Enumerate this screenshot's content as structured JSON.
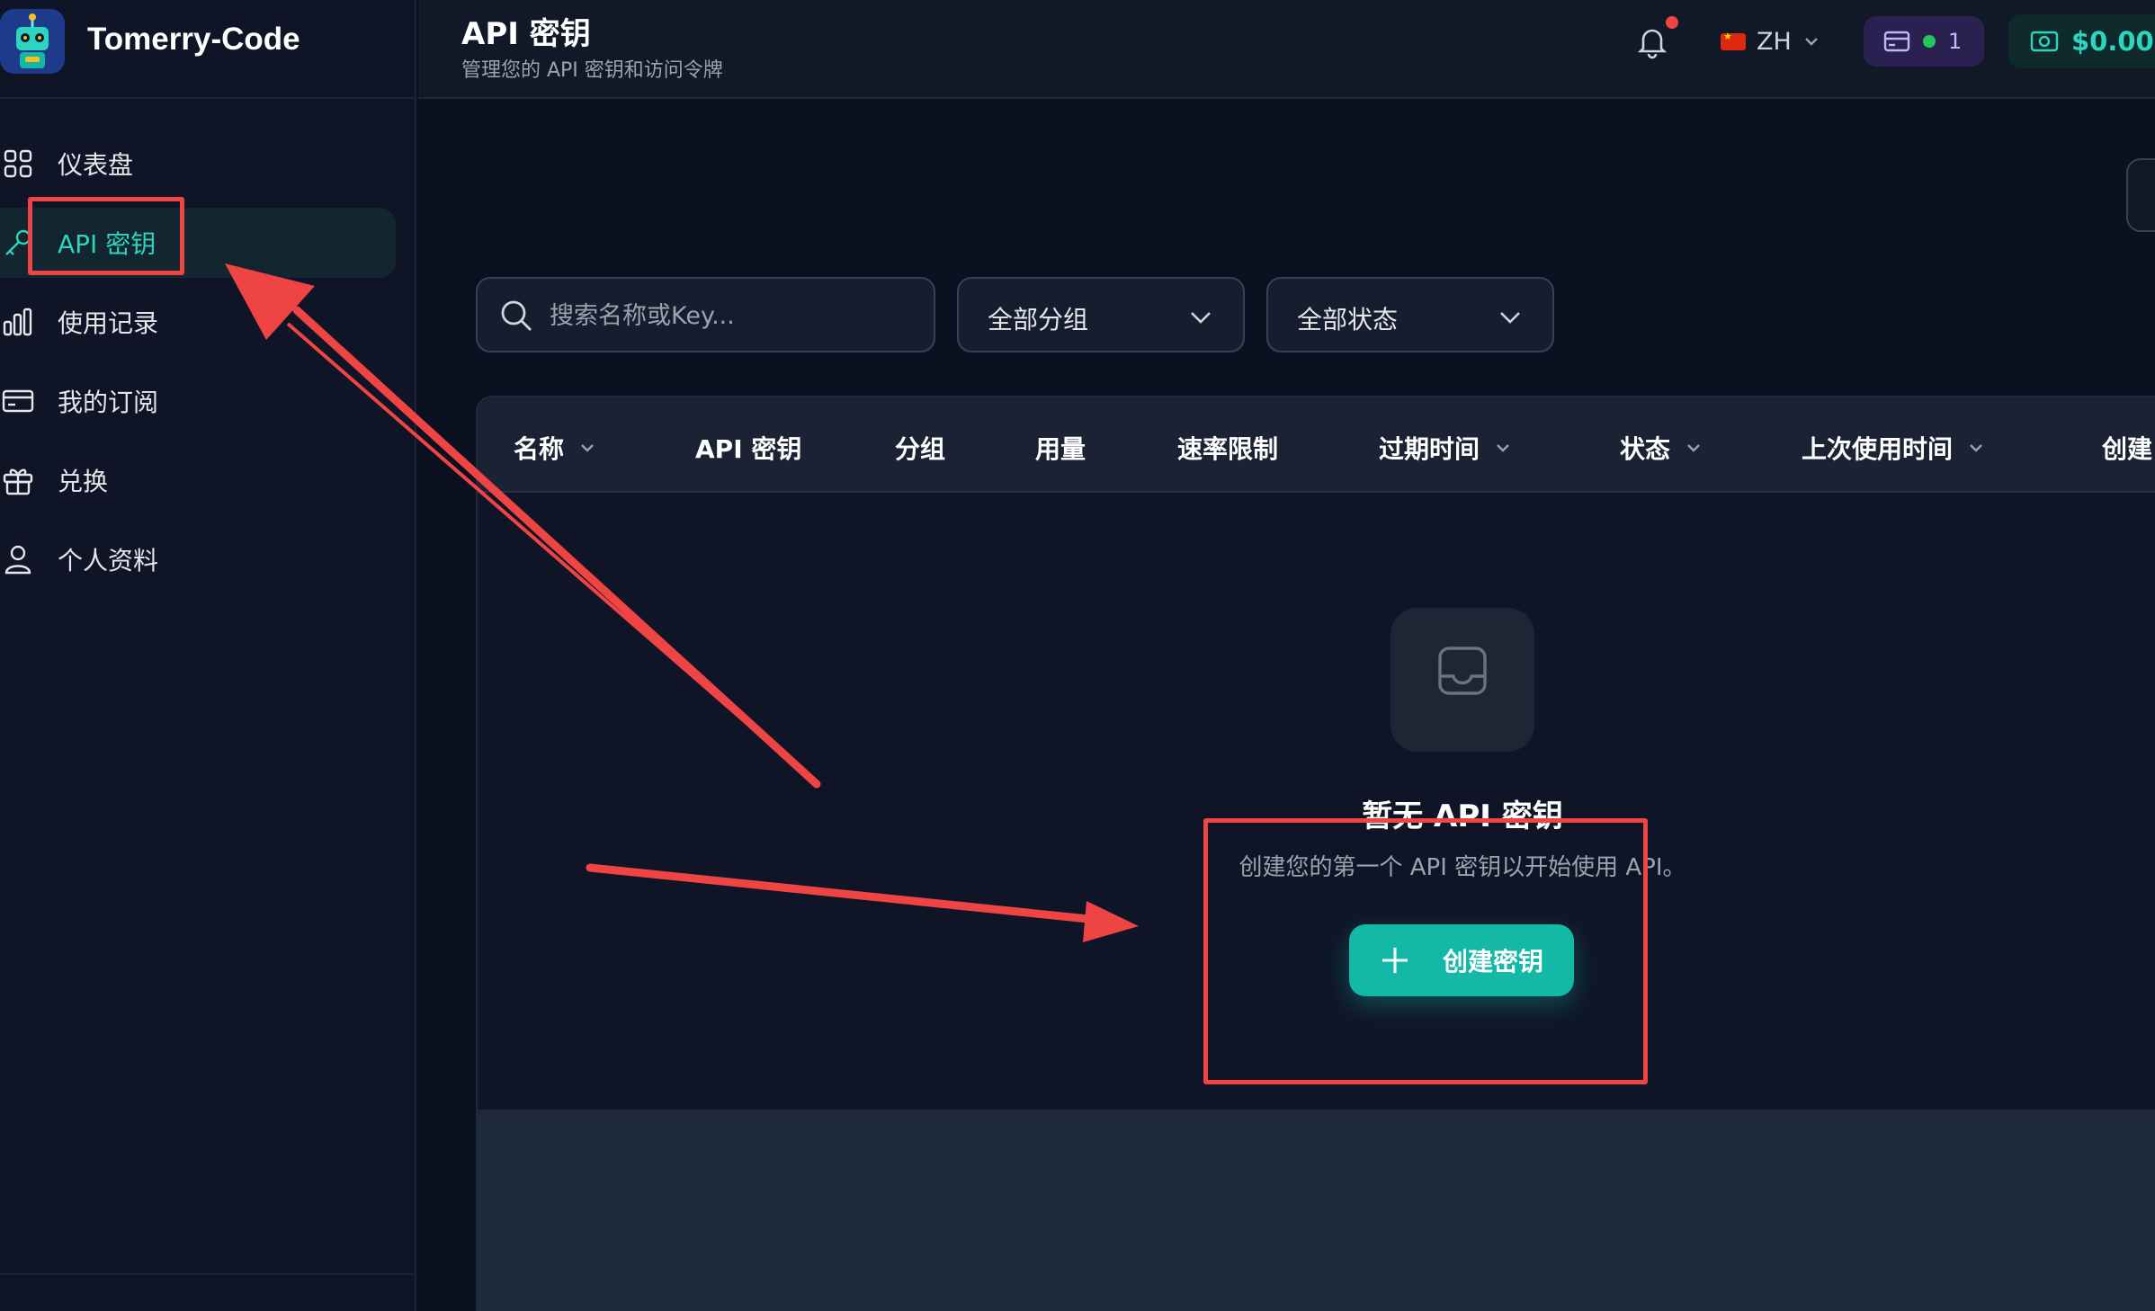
{
  "brand": {
    "name": "Tomerry-Code"
  },
  "sidebar": {
    "items": [
      {
        "label": "仪表盘",
        "icon": "dashboard-grid-icon",
        "active": false
      },
      {
        "label": "API 密钥",
        "icon": "key-icon",
        "active": true
      },
      {
        "label": "使用记录",
        "icon": "bar-chart-icon",
        "active": false
      },
      {
        "label": "我的订阅",
        "icon": "credit-card-icon",
        "active": false
      },
      {
        "label": "兑换",
        "icon": "gift-icon",
        "active": false
      },
      {
        "label": "个人资料",
        "icon": "user-icon",
        "active": false
      }
    ]
  },
  "header": {
    "title": "API 密钥",
    "subtitle": "管理您的 API 密钥和访问令牌",
    "language": "ZH",
    "subscription_count": "1",
    "balance": "$0.00"
  },
  "filters": {
    "search_placeholder": "搜索名称或Key...",
    "group_select": "全部分组",
    "status_select": "全部状态"
  },
  "table": {
    "columns": [
      "名称",
      "API 密钥",
      "分组",
      "用量",
      "速率限制",
      "过期时间",
      "状态",
      "上次使用时间",
      "创建"
    ]
  },
  "empty_state": {
    "title": "暂无 API 密钥",
    "description": "创建您的第一个 API 密钥以开始使用 API。",
    "button_label": "创建密钥"
  },
  "colors": {
    "accent": "#14b8a6",
    "annotation": "#ef4444",
    "background": "#0b1020",
    "sidebar": "#0f1526"
  }
}
